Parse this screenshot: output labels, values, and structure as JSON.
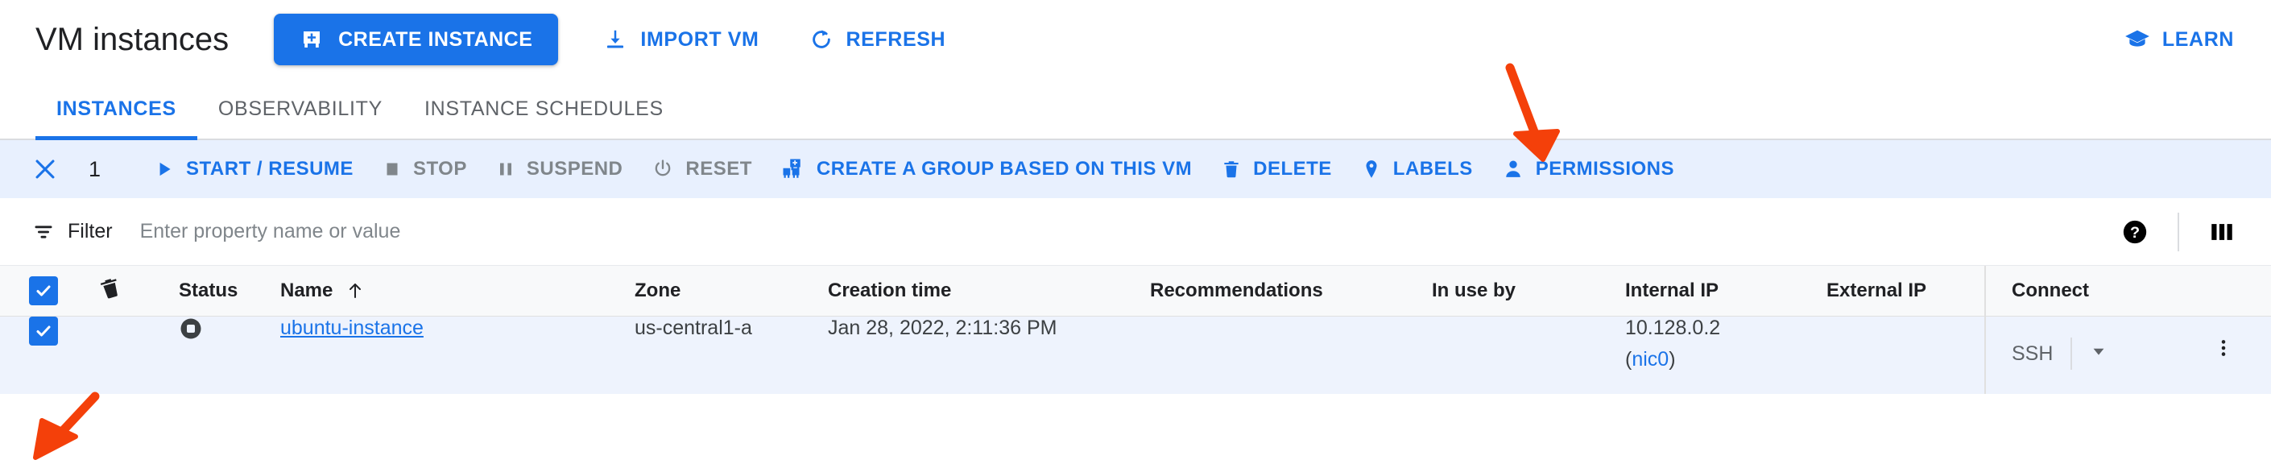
{
  "header": {
    "title": "VM instances",
    "create_label": "CREATE INSTANCE",
    "import_label": "IMPORT VM",
    "refresh_label": "REFRESH",
    "learn_label": "LEARN",
    "accent_color": "#1a73e8"
  },
  "tabs": [
    {
      "label": "INSTANCES",
      "active": true
    },
    {
      "label": "OBSERVABILITY",
      "active": false
    },
    {
      "label": "INSTANCE SCHEDULES",
      "active": false
    }
  ],
  "action_bar": {
    "selected_count": "1",
    "close_icon": "close-icon",
    "actions": [
      {
        "label": "START / RESUME",
        "icon": "play-icon",
        "enabled": true
      },
      {
        "label": "STOP",
        "icon": "stop-square-icon",
        "enabled": false
      },
      {
        "label": "SUSPEND",
        "icon": "pause-icon",
        "enabled": false
      },
      {
        "label": "RESET",
        "icon": "power-reset-icon",
        "enabled": false
      },
      {
        "label": "CREATE A GROUP BASED ON THIS VM",
        "icon": "group-vm-icon",
        "enabled": true
      },
      {
        "label": "DELETE",
        "icon": "trash-icon",
        "enabled": true
      },
      {
        "label": "LABELS",
        "icon": "tag-icon",
        "enabled": true
      },
      {
        "label": "PERMISSIONS",
        "icon": "person-icon",
        "enabled": true
      }
    ]
  },
  "filter_bar": {
    "label": "Filter",
    "placeholder": "Enter property name or value",
    "value": "",
    "help_icon": "help-circle-icon",
    "columns_icon": "column-display-icon"
  },
  "table": {
    "columns": [
      "Status",
      "Name",
      "Zone",
      "Creation time",
      "Recommendations",
      "In use by",
      "Internal IP",
      "External IP",
      "Connect"
    ],
    "sort_column": "Name",
    "sort_direction": "ascending",
    "header_checkbox_checked": true,
    "deletion_protection_icon": "deletion-protection-icon",
    "rows": [
      {
        "selected": true,
        "status": "stopped",
        "name": "ubuntu-instance",
        "zone": "us-central1-a",
        "creation_time": "Jan 28, 2022, 2:11:36 PM",
        "recommendations": "",
        "in_use_by": "",
        "internal_ip": "10.128.0.2",
        "internal_ip_nic": "nic0",
        "external_ip": "",
        "connect_label": "SSH"
      }
    ]
  },
  "annotations": {
    "arrow_color": "#f4400a",
    "arrow_delete": "arrow-pointing-to-delete",
    "arrow_checkbox": "arrow-pointing-to-row-checkbox"
  }
}
